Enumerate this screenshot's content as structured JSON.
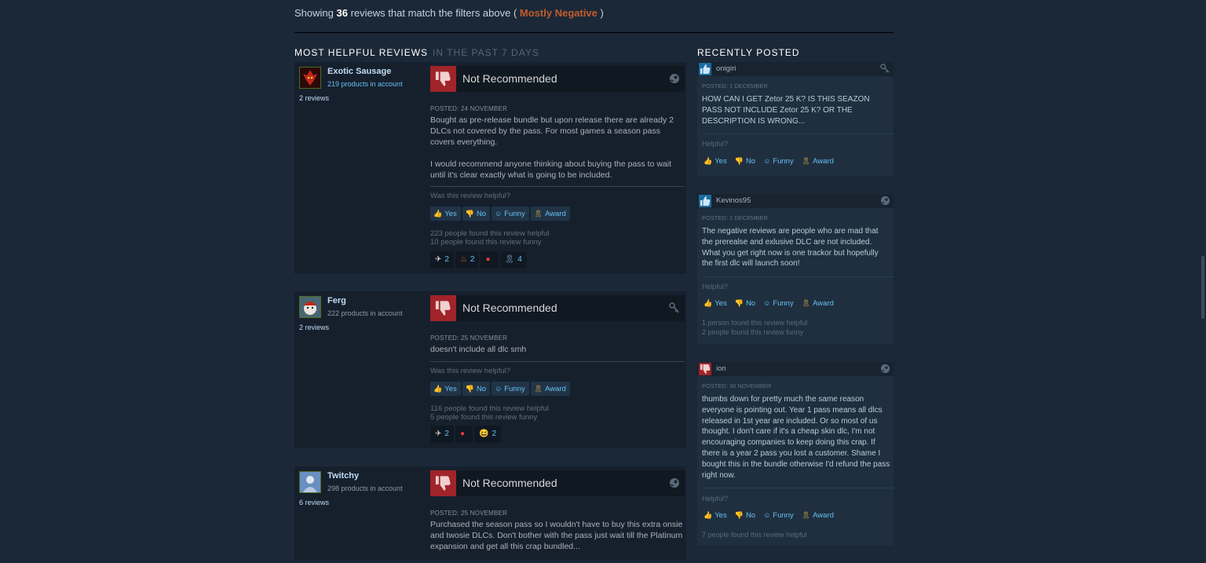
{
  "summary": {
    "prefix": "Showing",
    "count": "36",
    "middle": "reviews that match the filters above (",
    "rating": "Mostly Negative",
    "suffix": ")"
  },
  "sections": {
    "helpful_title": "MOST HELPFUL REVIEWS",
    "helpful_sub": "IN THE PAST 7 DAYS",
    "recent_title": "RECENTLY POSTED"
  },
  "labels": {
    "helpful_q": "Was this review helpful?",
    "yes": "Yes",
    "no": "No",
    "funny": "Funny",
    "award": "Award",
    "helpful_short": "Helpful?"
  },
  "reviews": [
    {
      "name": "Exotic Sausage",
      "products": "219 products in account",
      "review_count": "2 reviews",
      "verdict": "Not Recommended",
      "posted": "POSTED: 24 NOVEMBER",
      "text1": "Bought as pre-release bundle but upon release there are already 2 DLCs not covered by the pass. For most games a season pass covers everything.",
      "text2": "I would recommend anyone thinking about buying the pass to wait until it's clear exactly what is going to be included.",
      "found_helpful": "223 people found this review helpful",
      "found_funny": "10 people found this review funny",
      "awards": [
        {
          "icon": "wings-icon",
          "count": "2"
        },
        {
          "icon": "flame-icon",
          "count": "2"
        },
        {
          "icon": "candy-icon",
          "count": ""
        },
        {
          "icon": "ribbon-icon",
          "count": "4"
        }
      ]
    },
    {
      "name": "Ferg",
      "products": "222 products in account",
      "review_count": "2 reviews",
      "verdict": "Not Recommended",
      "posted": "POSTED: 25 NOVEMBER",
      "text1": "doesn't include all dlc smh",
      "found_helpful": "116 people found this review helpful",
      "found_funny": "5 people found this review funny",
      "awards": [
        {
          "icon": "wings-icon",
          "count": "2"
        },
        {
          "icon": "candy-icon",
          "count": ""
        },
        {
          "icon": "laughing-face-icon",
          "count": "2"
        }
      ]
    },
    {
      "name": "Twitchy",
      "products": "298 products in account",
      "review_count": "6 reviews",
      "verdict": "Not Recommended",
      "posted": "POSTED: 25 NOVEMBER",
      "text1": "Purchased the season pass so I wouldn't have to buy this extra onsie and twosie DLCs. Don't bother with the pass just wait till the Platinum expansion and get all this crap bundled..."
    }
  ],
  "recent": [
    {
      "name": "onigiri",
      "thumb": "up",
      "posted": "POSTED: 1 DECEMBER",
      "text": "HOW CAN I GET Zetor 25 K? IS THIS SEAZON PASS NOT INCLUDE Zetor 25 K? OR THE DESCRIPTION IS WRONG..."
    },
    {
      "name": "Kevinos95",
      "thumb": "up",
      "posted": "POSTED: 1 DECEMBER",
      "text": "The negative reviews are people who are mad that the prerealse and exlusive DLC are not included. What you get right now is one trackor but hopefully the first dlc will launch soon!",
      "found_helpful": "1 person found this review helpful",
      "found_funny": "2 people found this review funny"
    },
    {
      "name": "ion",
      "thumb": "down",
      "posted": "POSTED: 30 NOVEMBER",
      "text": "thumbs down for pretty much the same reason everyone is pointing out. Year 1 pass means all dlcs released in 1st year are included. Or so most of us thought. I don't care if it's a cheap skin dlc, I'm not encouraging companies to keep doing this crap. If there is a year 2 pass you lost a customer. Shame I bought this in the bundle otherwise I'd refund the pass right now.",
      "found_helpful": "7 people found this review helpful"
    }
  ],
  "colors": {
    "background": "#1b2838",
    "thumb_down": "#a0242a",
    "thumb_up": "#1a6ca0",
    "link": "#66c0f4",
    "negative": "#c35c2c"
  }
}
